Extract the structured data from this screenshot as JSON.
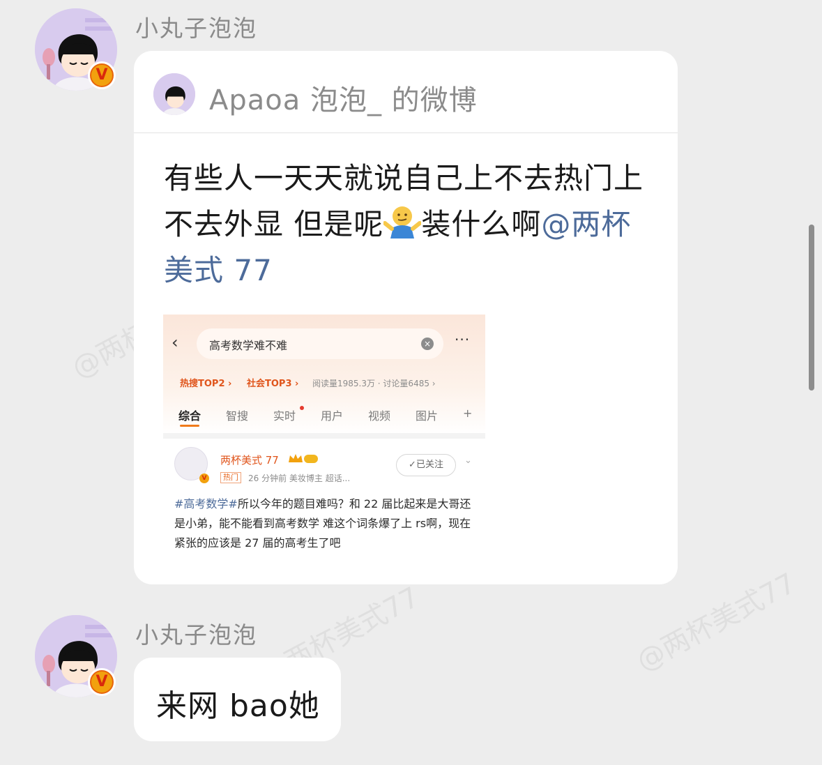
{
  "watermark": "@两杯美式77",
  "messages": [
    {
      "sender": "小丸子泡泡",
      "avatar_icon": "chibi-maruko-avatar-icon",
      "badge": "V",
      "card": {
        "source_title": "Apaoa 泡泡_ 的微博",
        "text_part1": "有些人一天天就说自己上不去热门上不去外显 但是呢",
        "emoji_icon": "shrug-emoji-icon",
        "text_part2": "装什么啊",
        "mention": "@两杯美式 77",
        "screenshot": {
          "back_icon": "‹",
          "search_query": "高考数学难不难",
          "clear_icon": "×",
          "more_icon": "···",
          "tags": [
            "热搜TOP2 ›",
            "社会TOP3 ›"
          ],
          "stats": "阅读量1985.3万 · 讨论量6485 ›",
          "tabs": [
            "综合",
            "智搜",
            "实时",
            "用户",
            "视频",
            "图片",
            "+"
          ],
          "post": {
            "username": "两杯美式 77",
            "hot_label": "热门",
            "meta": "26 分钟前  美妆博主 超话...",
            "follow_label": "✓已关注",
            "hashtag": "#高考数学#",
            "body": "所以今年的题目难吗？和 22 届比起来是大哥还是小弟，能不能看到高考数学 难这个词条爆了上 rs啊，现在紧张的应该是 27 届的高考生了吧"
          }
        }
      }
    },
    {
      "sender": "小丸子泡泡",
      "avatar_icon": "chibi-maruko-avatar-icon",
      "badge": "V",
      "text": "来网 bao她"
    }
  ],
  "colors": {
    "background": "#ededed",
    "bubble": "#ffffff",
    "mention": "#4d6b9a",
    "sender": "#8a8a8a",
    "verified_badge": "#f2a10e"
  }
}
